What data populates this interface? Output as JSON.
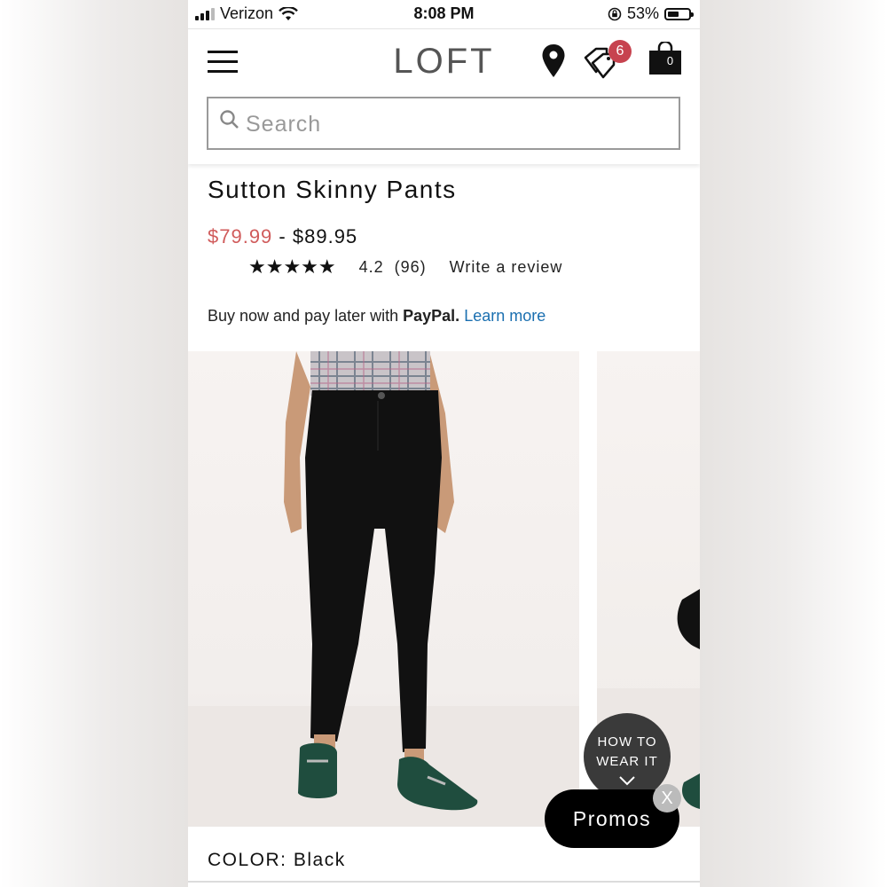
{
  "status_bar": {
    "carrier": "Verizon",
    "time": "8:08 PM",
    "battery_percent": "53%",
    "battery_level": 0.53,
    "icons": [
      "signal-bars-icon",
      "wifi-icon",
      "orientation-lock-icon",
      "battery-icon"
    ]
  },
  "header": {
    "logo": "LOFT",
    "menu_icon": "hamburger-menu-icon",
    "store_locator_icon": "map-pin-icon",
    "offers_icon": "price-tags-icon",
    "offers_badge": "6",
    "bag_icon": "shopping-bag-icon",
    "bag_count": "0",
    "badge_color": "#c7434f"
  },
  "search": {
    "placeholder": "Search",
    "value": "",
    "icon": "search-icon"
  },
  "product": {
    "title": "Sutton Skinny Pants",
    "sale_price": "$79.99",
    "price_separator": "-",
    "regular_price": "$89.95",
    "stars": "★★★★★",
    "rating_value": "4.2",
    "review_count": "(96)",
    "write_review": "Write a review",
    "sale_color": "#d05b5b"
  },
  "paypal": {
    "text": "Buy now and pay later with",
    "brand": "PayPal.",
    "link": "Learn more",
    "link_color": "#1a6fb0"
  },
  "gallery": {
    "how_to_wear_line1": "HOW TO",
    "how_to_wear_line2": "WEAR IT"
  },
  "promos": {
    "label": "Promos",
    "close": "X"
  },
  "color": {
    "label": "COLOR:",
    "value": "Black"
  }
}
